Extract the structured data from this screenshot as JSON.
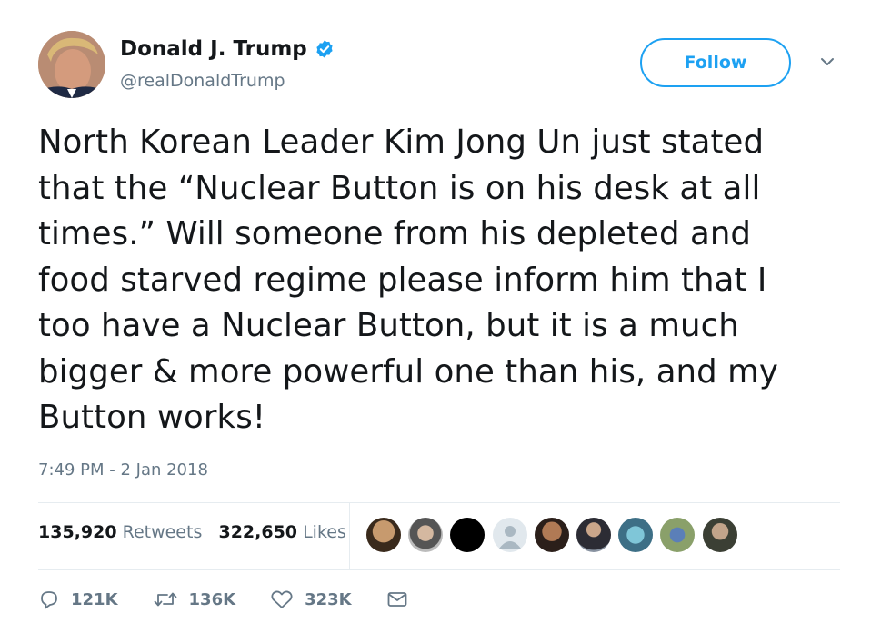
{
  "author": {
    "name": "Donald J. Trump",
    "handle": "@realDonaldTrump",
    "verified": true
  },
  "follow_label": "Follow",
  "tweet": {
    "lines": [
      "North Korean Leader Kim Jong Un just stated",
      "that the “Nuclear Button is on his desk at all",
      "times.” Will someone from his depleted and",
      "food starved regime please inform him that I",
      "too have a Nuclear Button, but it is a much",
      "bigger & more powerful one than his, and my",
      "Button works!"
    ],
    "timestamp": "7:49 PM - 2 Jan 2018"
  },
  "stats": {
    "retweets_count": "135,920",
    "retweets_label": "Retweets",
    "likes_count": "322,650",
    "likes_label": "Likes"
  },
  "actions": {
    "replies": "121K",
    "retweets": "136K",
    "likes": "323K"
  },
  "colors": {
    "accent": "#1da1f2",
    "muted": "#657786",
    "divider": "#e6ecf0"
  }
}
